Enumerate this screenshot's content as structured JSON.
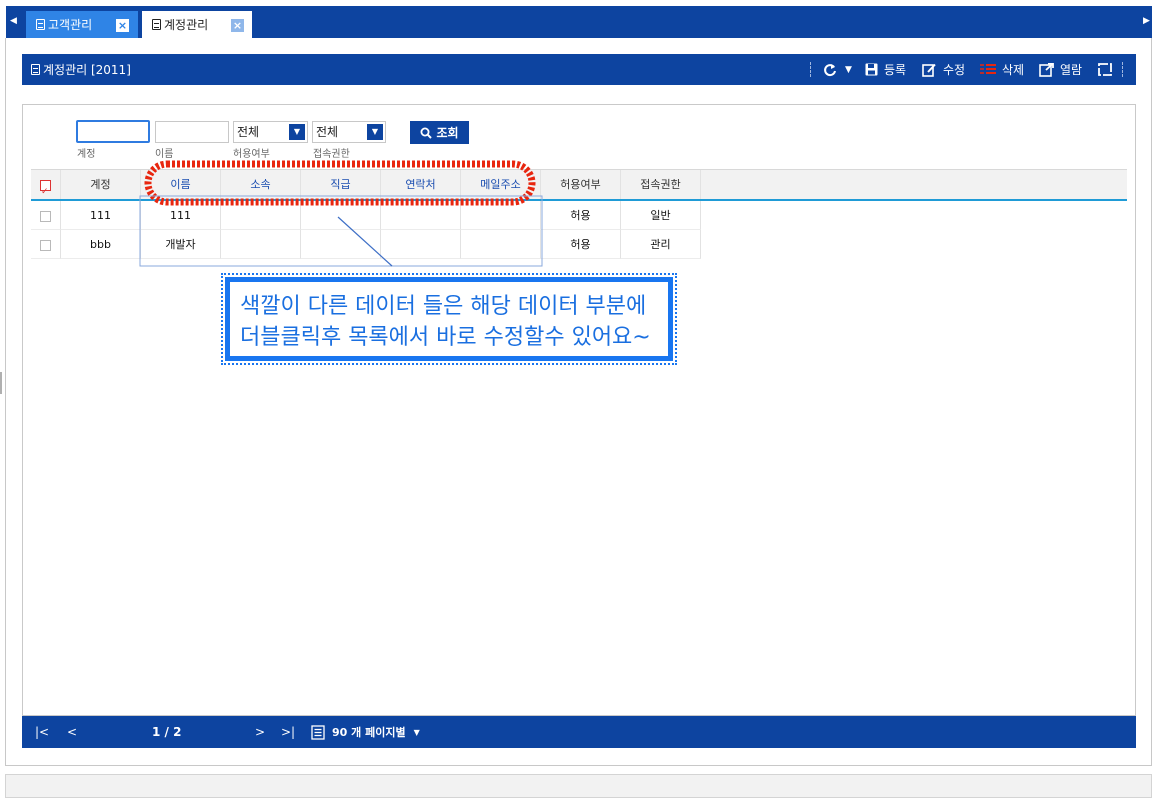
{
  "tabs": {
    "items": [
      {
        "label": "고객관리"
      },
      {
        "label": "계정관리"
      }
    ],
    "close_glyph": "×"
  },
  "titlebar": {
    "title": "계정관리 [2011]",
    "buttons": {
      "register": "등록",
      "edit": "수정",
      "delete": "삭제",
      "view": "열람"
    }
  },
  "search": {
    "account_label": "계정",
    "name_label": "이름",
    "allow_label": "허용여부",
    "access_label": "접속권한",
    "allow_value": "전체",
    "access_value": "전체",
    "button": "조회"
  },
  "grid": {
    "columns": [
      "계정",
      "이름",
      "소속",
      "직급",
      "연락처",
      "메일주소",
      "허용여부",
      "접속권한"
    ],
    "rows": [
      {
        "account": "111",
        "name": "111",
        "dept": "",
        "rank": "",
        "phone": "",
        "email": "",
        "allow": "허용",
        "access": "일반"
      },
      {
        "account": "bbb",
        "name": "개발자",
        "dept": "",
        "rank": "",
        "phone": "",
        "email": "",
        "allow": "허용",
        "access": "관리"
      }
    ]
  },
  "annotation": {
    "line1": "색깔이 다른 데이터 들은 해당 데이터 부분에",
    "line2": "더블클릭후 목록에서 바로 수정할수 있어요~"
  },
  "pager": {
    "page_info": "1 / 2",
    "page_size": "90 개 페이지별"
  },
  "colors": {
    "primary": "#0d44a0",
    "tab_inactive": "#2f84e6",
    "header_underline": "#1f9bd6",
    "highlight_red": "#e8260f",
    "annotation_blue": "#1976f0"
  }
}
